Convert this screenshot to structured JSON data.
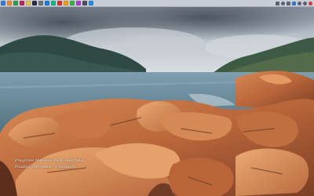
{
  "wallpaper": {
    "caption_line_1": "Freycinet National Park, Australia",
    "caption_line_2": "Pixabay (Mirosław - Unsplash)"
  },
  "top_bar": {
    "launcher_icons": [
      {
        "name": "files-icon",
        "color": "#3a7bd5"
      },
      {
        "name": "browser-icon",
        "color": "#f08a24"
      },
      {
        "name": "mail-icon",
        "color": "#2f9e44"
      },
      {
        "name": "music-icon",
        "color": "#c2255c"
      },
      {
        "name": "photos-icon",
        "color": "#e8c547"
      },
      {
        "name": "terminal-icon",
        "color": "#2b2d42"
      },
      {
        "name": "settings-icon",
        "color": "#6c757d"
      },
      {
        "name": "store-icon",
        "color": "#1c7ed6"
      },
      {
        "name": "chat-icon",
        "color": "#12b886"
      },
      {
        "name": "calendar-icon",
        "color": "#e03131"
      },
      {
        "name": "notes-icon",
        "color": "#f59f00"
      },
      {
        "name": "maps-icon",
        "color": "#37b24d"
      },
      {
        "name": "video-icon",
        "color": "#ae3ec9"
      },
      {
        "name": "editor-icon",
        "color": "#495057"
      },
      {
        "name": "downloads-icon",
        "color": "#228be6"
      }
    ],
    "tray_icons": [
      "network-icon",
      "volume-icon",
      "battery-icon",
      "bluetooth-icon",
      "notification-icon",
      "user-icon",
      "power-icon"
    ]
  }
}
